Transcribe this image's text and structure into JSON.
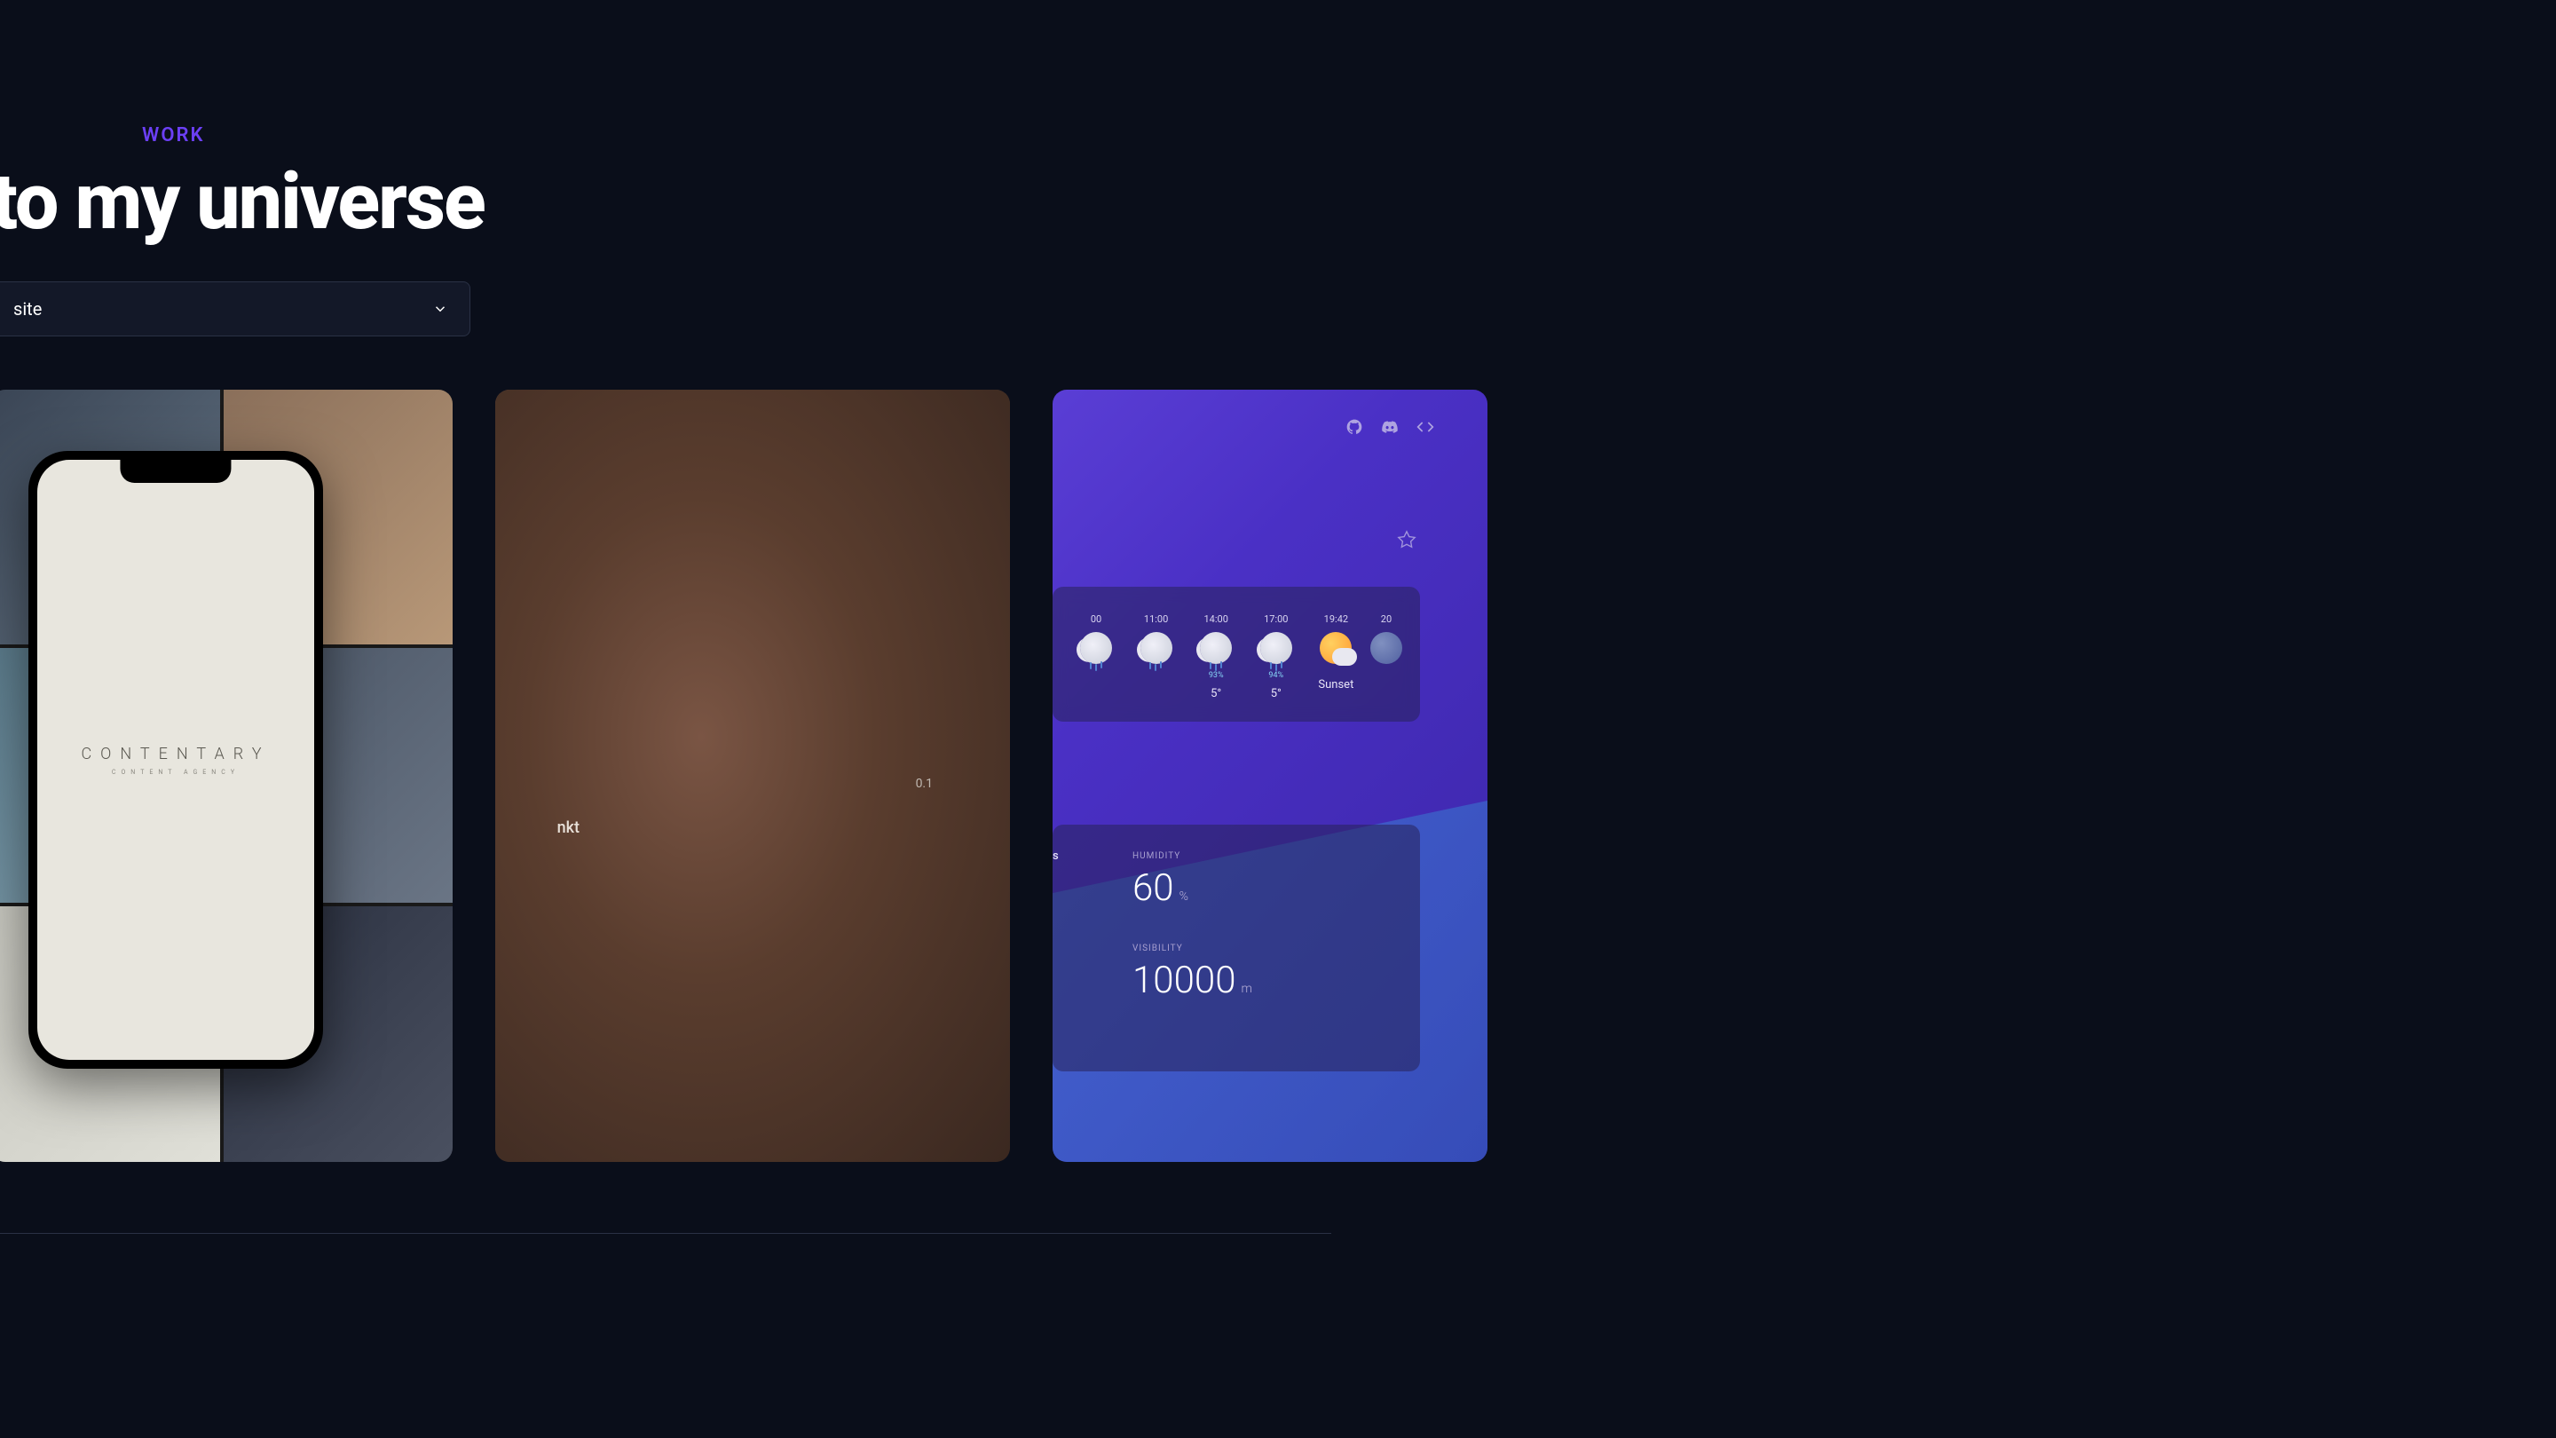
{
  "header": {
    "section_label": "WORK",
    "heading": "to my universe"
  },
  "filter": {
    "selected": "site"
  },
  "cards": {
    "card1": {
      "phone_brand_main": "CONTENTARY",
      "phone_brand_sub": "CONTENT AGENCY"
    },
    "card2": {
      "device_value": "0.1",
      "device_brand": "nkt"
    },
    "card3": {
      "weather_hours": [
        {
          "time": "00",
          "icon": "cloud-rain",
          "pct": "",
          "temp": ""
        },
        {
          "time": "11:00",
          "icon": "cloud-rain",
          "pct": "",
          "temp": ""
        },
        {
          "time": "14:00",
          "icon": "cloud-rain",
          "pct": "93%",
          "temp": "5°"
        },
        {
          "time": "17:00",
          "icon": "cloud-rain",
          "pct": "94%",
          "temp": "5°"
        },
        {
          "time": "19:42",
          "icon": "sun-partial",
          "pct": "",
          "temp": "Sunset"
        },
        {
          "time": "20",
          "icon": "moon",
          "pct": "",
          "temp": ""
        }
      ],
      "details_header": "s",
      "details": [
        {
          "label": "HUMIDITY",
          "value": "60",
          "unit": "%"
        },
        {
          "label": "VISIBILITY",
          "value": "10000",
          "unit": "m"
        }
      ]
    }
  }
}
